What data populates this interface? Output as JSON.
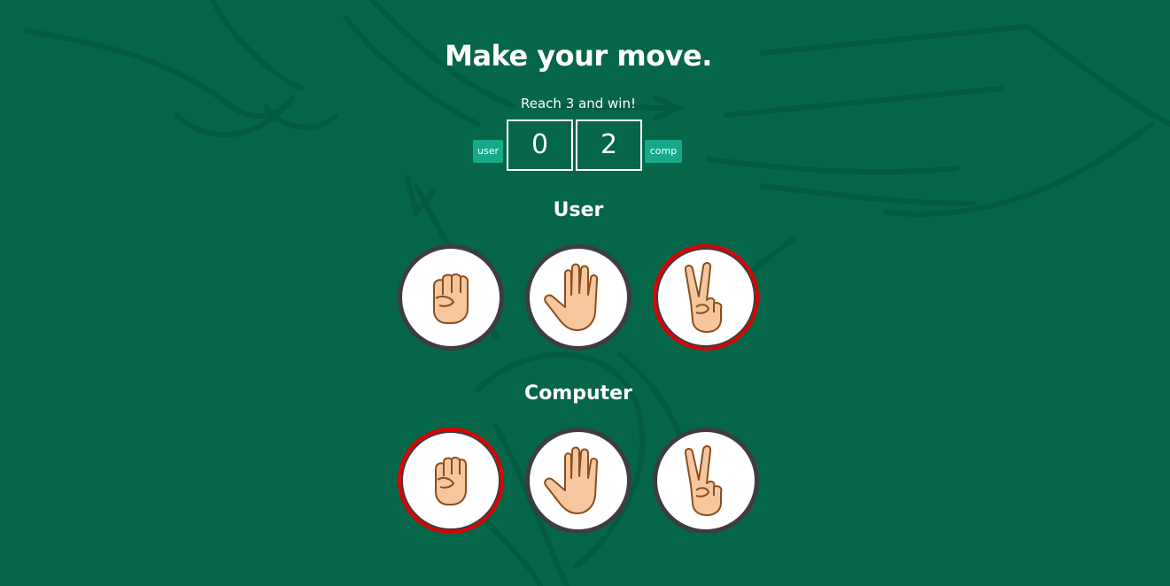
{
  "title": "Make your move.",
  "subtitle": "Reach 3 and win!",
  "scoreboard": {
    "user_badge": "user",
    "comp_badge": "comp",
    "user_score": "0",
    "comp_score": "2"
  },
  "user_section": {
    "label": "User",
    "choices": [
      {
        "icon": "rock-fist-icon",
        "selected": false
      },
      {
        "icon": "paper-hand-icon",
        "selected": false
      },
      {
        "icon": "scissors-hand-icon",
        "selected": true
      }
    ]
  },
  "computer_section": {
    "label": "Computer",
    "choices": [
      {
        "icon": "rock-fist-icon",
        "selected": true
      },
      {
        "icon": "paper-hand-icon",
        "selected": false
      },
      {
        "icon": "scissors-hand-icon",
        "selected": false
      }
    ]
  },
  "colors": {
    "background": "#06664a",
    "badge": "#16a98a",
    "selected_ring": "#e00000",
    "ring": "#3e3c43",
    "skin": "#f6c79e",
    "outline": "#8a4e1c"
  }
}
